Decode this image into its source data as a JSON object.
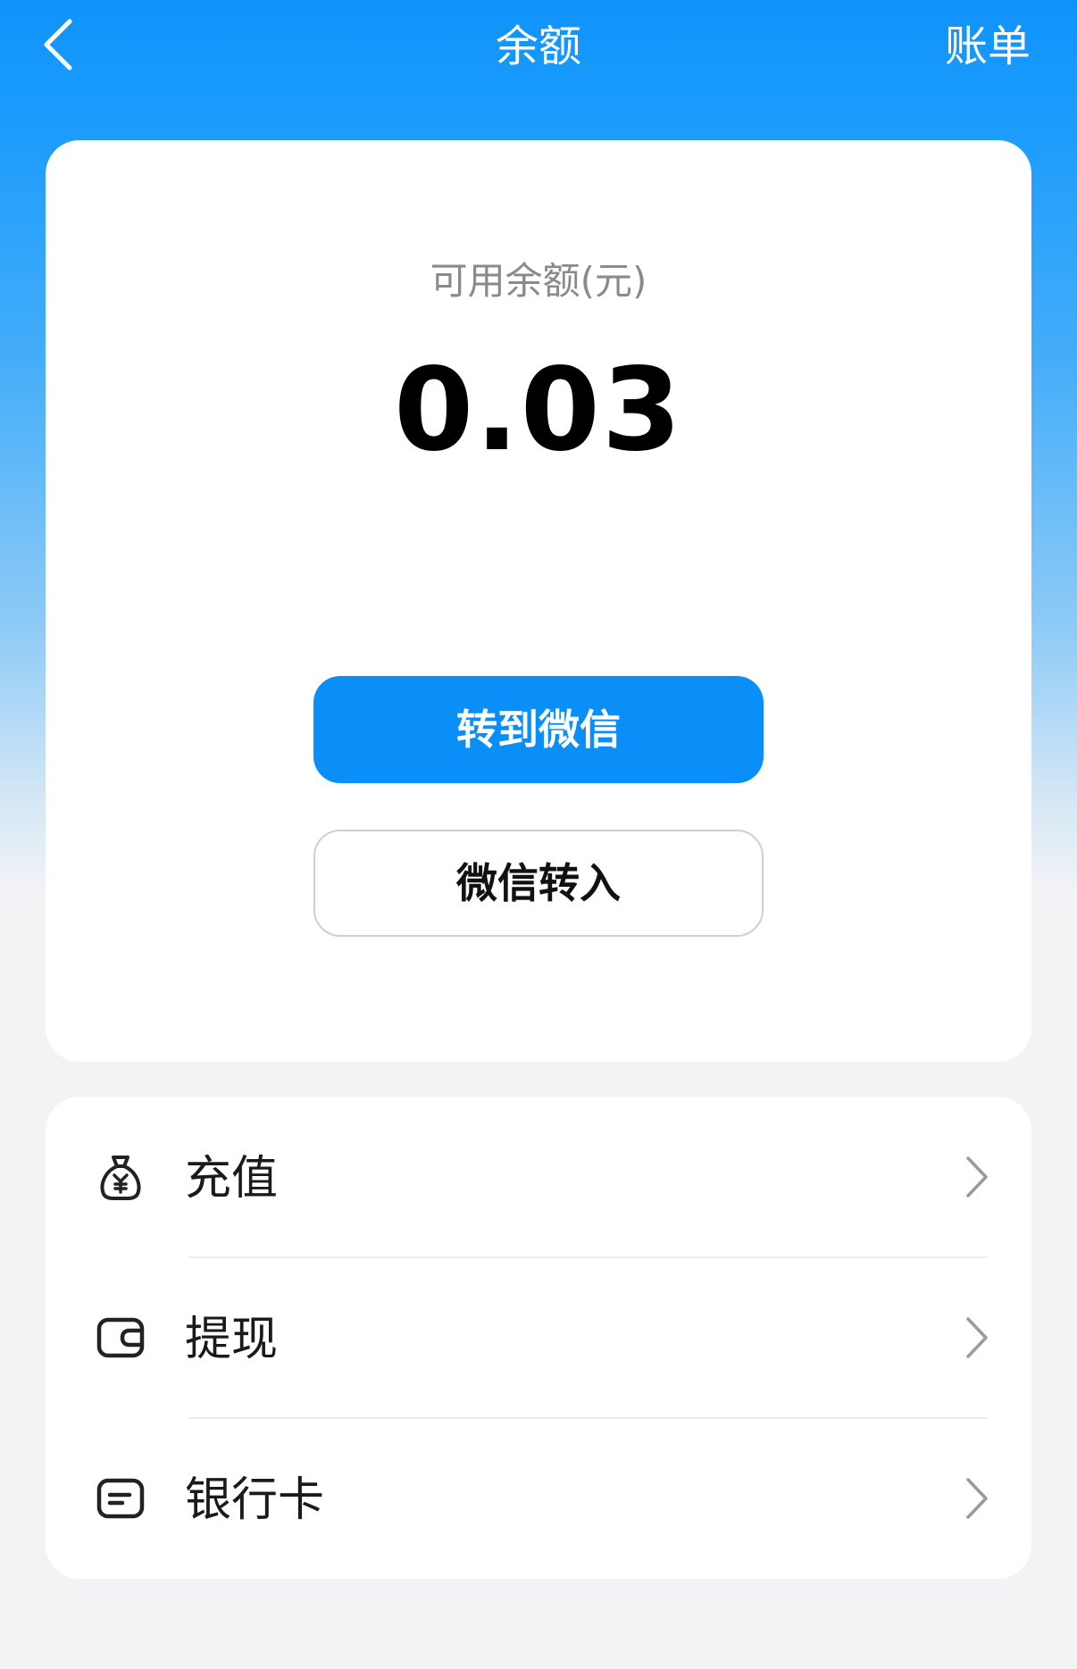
{
  "nav": {
    "title": "余额",
    "action_label": "账单",
    "back_icon": "chevron-left-icon"
  },
  "balance": {
    "label": "可用余额(元)",
    "amount": "0.03"
  },
  "buttons": {
    "primary": "转到微信",
    "secondary": "微信转入"
  },
  "menu": {
    "items": [
      {
        "label": "充值",
        "icon": "money-bag-icon"
      },
      {
        "label": "提现",
        "icon": "wallet-icon"
      },
      {
        "label": "银行卡",
        "icon": "bank-card-icon"
      }
    ]
  },
  "colors": {
    "accent": "#0a8ff8",
    "header_blue": "#0f93fb",
    "page_background": "#f3f3f5",
    "card_background": "#ffffff"
  }
}
